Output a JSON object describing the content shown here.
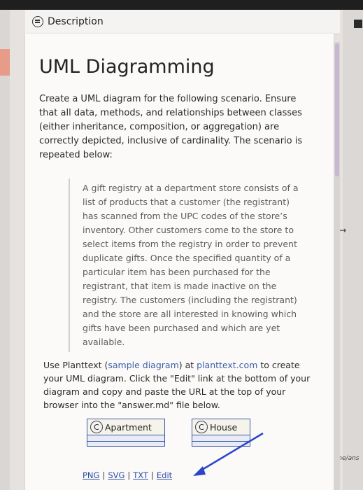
{
  "tab": {
    "label": "Description",
    "icon": "document-icon"
  },
  "title": "UML Diagramming",
  "intro": "Create a UML diagram for the following scenario. Ensure that all data, methods, and relationships between classes (either inheritance, composition, or aggregation) are correctly depicted, inclusive of cardinality. The scenario is repeated below:",
  "scenario": "A gift registry at a department store consists of a list of products that a customer (the registrant) has scanned from the UPC codes of the store’s inventory. Other customers come to the store to select items from the registry in order to prevent duplicate gifts. Once the specified quantity of a particular item has been purchased for the registrant, that item is made inactive on the registry. The customers (including the registrant) and the store are all interested in knowing which gifts have been purchased and which are yet available.",
  "instructions": {
    "part1": "Use Planttext (",
    "sample_link": "sample diagram",
    "part2": ") at ",
    "site_link": "planttext.com",
    "part3": " to create your UML diagram. Click the \"Edit\" link at the bottom of your diagram and copy and paste the URL at the top of your browser into the \"answer.md\" file below."
  },
  "diagram": {
    "class1": {
      "stereotype": "C",
      "name": "Apartment"
    },
    "class2": {
      "stereotype": "C",
      "name": "House"
    }
  },
  "links": {
    "png": "PNG",
    "svg": "SVG",
    "txt": "TXT",
    "edit": "Edit",
    "separator": "|"
  },
  "side": {
    "path_text": "/home/ans"
  },
  "colors": {
    "accent": "#e89b88",
    "uml_border": "#3a5aa8",
    "annotation": "#2b45c8",
    "link": "#3b5fa8"
  }
}
